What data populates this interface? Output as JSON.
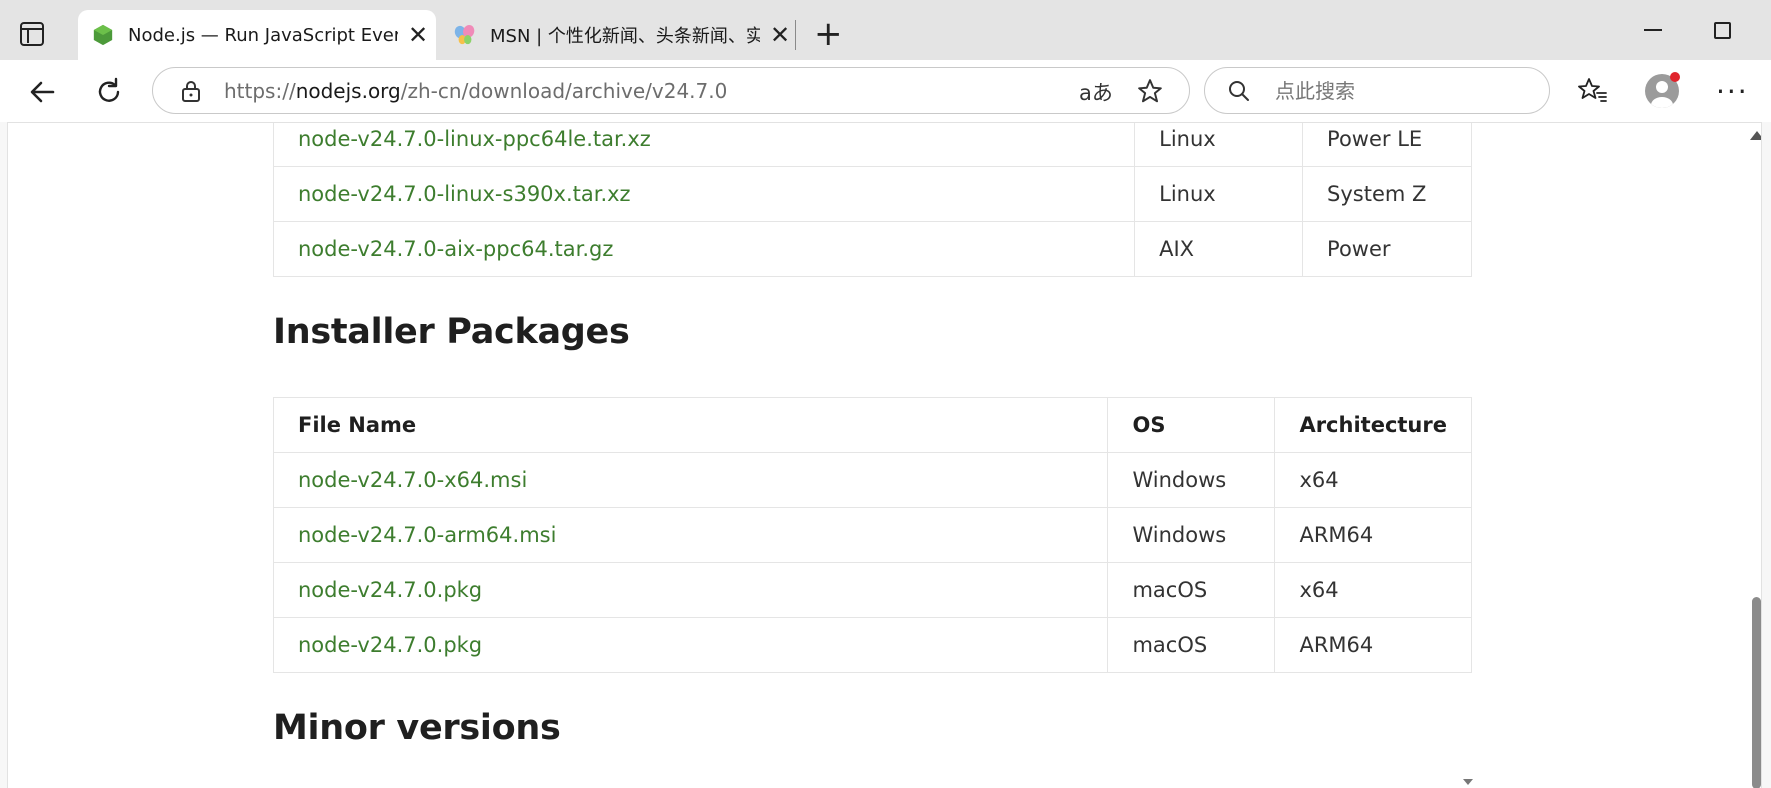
{
  "browser": {
    "tabs": [
      {
        "title": "Node.js — Run JavaScript Everywhere",
        "active": true,
        "favicon": "nodejs-hexagon-icon"
      },
      {
        "title": "MSN | 个性化新闻、头条新闻、实时",
        "active": false,
        "favicon": "msn-butterfly-icon"
      }
    ],
    "address": {
      "url_prefix": "https://",
      "url_host": "nodejs.org",
      "url_path": "/zh-cn/download/archive/v24.7.0",
      "read_aloud_label": "aあ"
    },
    "search": {
      "placeholder": "点此搜索"
    },
    "colors": {
      "tabstrip": "#e4e4e4",
      "toolbar": "#ffffff",
      "notification_badge": "#e0242c"
    }
  },
  "page": {
    "binary_rows": [
      {
        "file": "node-v24.7.0-linux-ppc64le.tar.xz",
        "os": "Linux",
        "arch": "Power LE"
      },
      {
        "file": "node-v24.7.0-linux-s390x.tar.xz",
        "os": "Linux",
        "arch": "System Z"
      },
      {
        "file": "node-v24.7.0-aix-ppc64.tar.gz",
        "os": "AIX",
        "arch": "Power"
      }
    ],
    "installer_heading": "Installer Packages",
    "installer_columns": {
      "file": "File Name",
      "os": "OS",
      "arch": "Architecture"
    },
    "installer_rows": [
      {
        "file": "node-v24.7.0-x64.msi",
        "os": "Windows",
        "arch": "x64"
      },
      {
        "file": "node-v24.7.0-arm64.msi",
        "os": "Windows",
        "arch": "ARM64"
      },
      {
        "file": "node-v24.7.0.pkg",
        "os": "macOS",
        "arch": "x64"
      },
      {
        "file": "node-v24.7.0.pkg",
        "os": "macOS",
        "arch": "ARM64"
      }
    ],
    "minor_heading": "Minor versions",
    "colors": {
      "link": "#3d7d2e",
      "heading": "#1f1f1f",
      "border": "#e5e5e5"
    }
  }
}
